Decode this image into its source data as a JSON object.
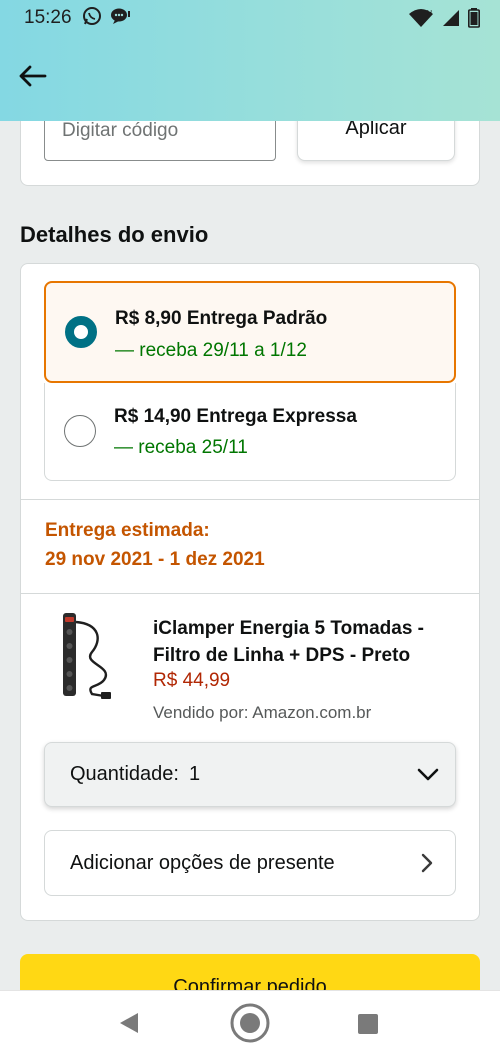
{
  "status_bar": {
    "time": "15:26"
  },
  "coupon": {
    "placeholder": "Digitar código",
    "apply_label": "Aplicar"
  },
  "shipping": {
    "section_title": "Detalhes do envio",
    "options": [
      {
        "title": "R$ 8,90 Entrega Padrão",
        "subtitle": "— receba 29/11 a 1/12",
        "selected": true
      },
      {
        "title": "R$ 14,90 Entrega Expressa",
        "subtitle": "— receba 25/11",
        "selected": false
      }
    ],
    "estimated_label": "Entrega estimada:",
    "estimated_date": "29 nov 2021 - 1 dez 2021"
  },
  "product": {
    "title": "iClamper Energia 5 Tomadas - Filtro de Linha + DPS - Preto",
    "price": "R$ 44,99",
    "seller": "Vendido por: Amazon.com.br"
  },
  "quantity": {
    "label": "Quantidade:",
    "value": "1"
  },
  "gift": {
    "label": "Adicionar opções de presente"
  },
  "confirm": {
    "label": "Confirmar pedido"
  },
  "colors": {
    "accent_teal": "#007185",
    "selected_border": "#e77600",
    "delivery_green": "#007600",
    "estimate_orange": "#c45500",
    "price_red": "#b12704",
    "confirm_yellow": "#ffd814"
  },
  "icons": {
    "back": "arrow-left-icon",
    "whatsapp": "whatsapp-icon",
    "messenger": "chat-icon",
    "wifi": "wifi-icon",
    "signal": "signal-icon",
    "battery": "battery-icon",
    "chevron_down": "chevron-down-icon",
    "chevron_right": "chevron-right-icon"
  }
}
